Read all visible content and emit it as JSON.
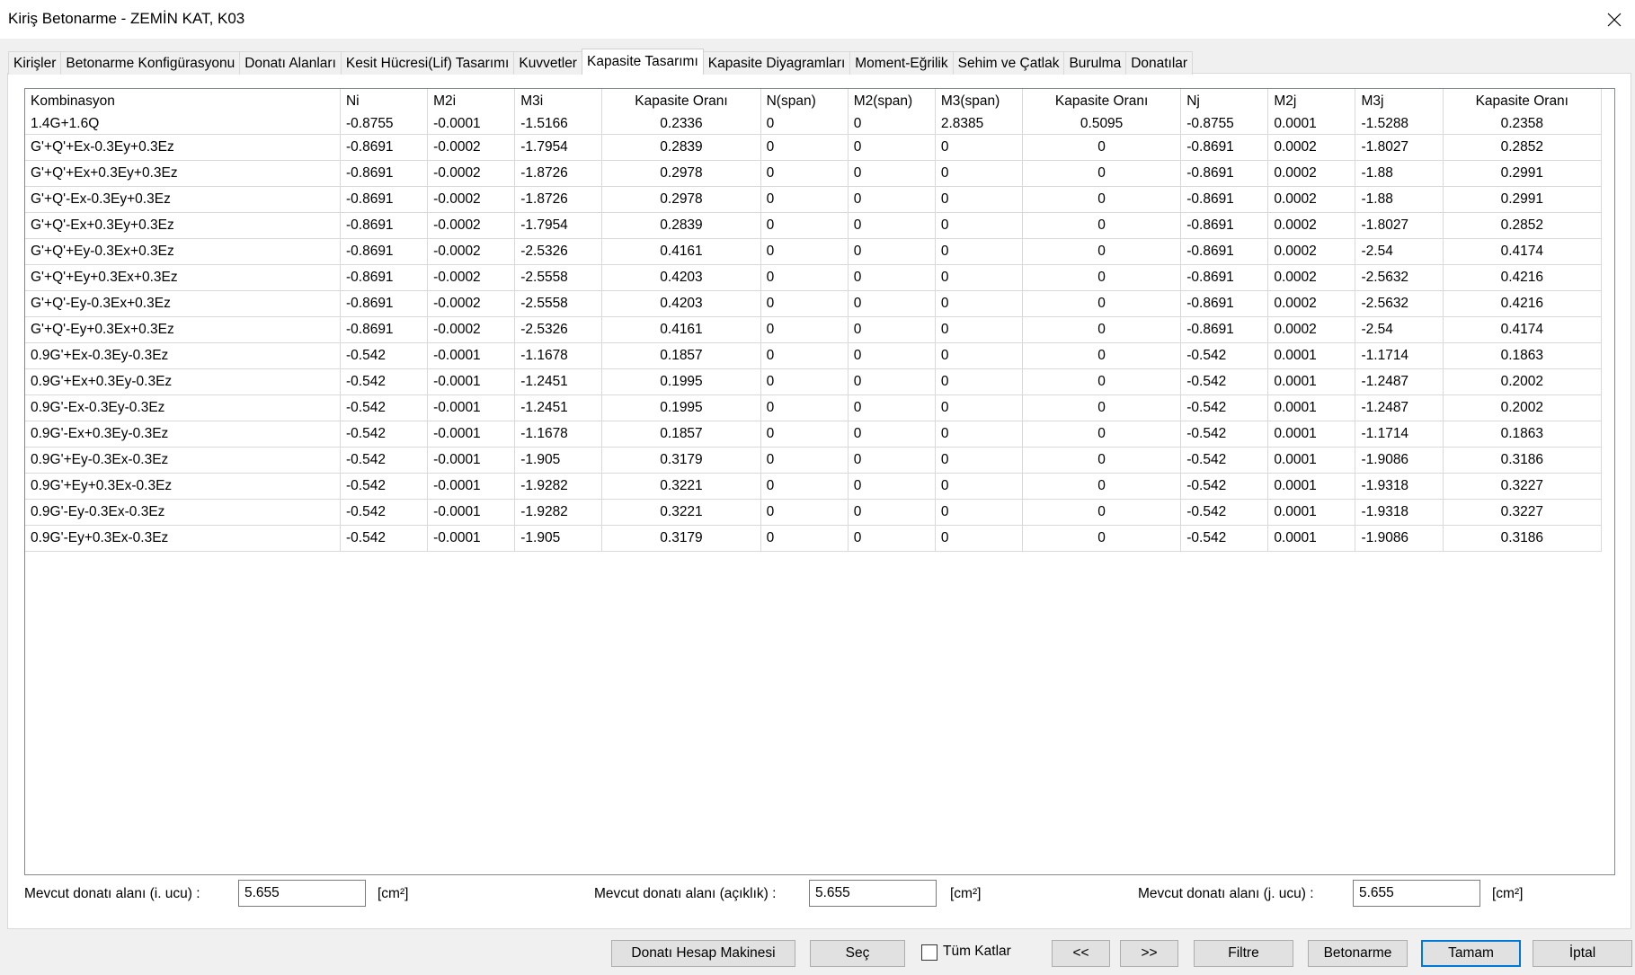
{
  "window": {
    "title": "Kiriş Betonarme - ZEMİN KAT, K03"
  },
  "tabs": [
    {
      "label": "Kirişler"
    },
    {
      "label": "Betonarme Konfigürasyonu"
    },
    {
      "label": "Donatı Alanları"
    },
    {
      "label": "Kesit Hücresi(Lif) Tasarımı"
    },
    {
      "label": "Kuvvetler"
    },
    {
      "label": "Kapasite Tasarımı",
      "active": true
    },
    {
      "label": "Kapasite Diyagramları"
    },
    {
      "label": "Moment-Eğrilik"
    },
    {
      "label": "Sehim ve Çatlak"
    },
    {
      "label": "Burulma"
    },
    {
      "label": "Donatılar"
    }
  ],
  "table": {
    "columns": [
      "Kombinasyon",
      "Ni",
      "M2i",
      "M3i",
      "Kapasite Oranı",
      "N(span)",
      "M2(span)",
      "M3(span)",
      "Kapasite Oranı",
      "Nj",
      "M2j",
      "M3j",
      "Kapasite Oranı"
    ],
    "rows": [
      [
        "1.4G+1.6Q",
        "-0.8755",
        "-0.0001",
        "-1.5166",
        "0.2336",
        "0",
        "0",
        "2.8385",
        "0.5095",
        "-0.8755",
        "0.0001",
        "-1.5288",
        "0.2358"
      ],
      [
        "G'+Q'+Ex-0.3Ey+0.3Ez",
        "-0.8691",
        "-0.0002",
        "-1.7954",
        "0.2839",
        "0",
        "0",
        "0",
        "0",
        "-0.8691",
        "0.0002",
        "-1.8027",
        "0.2852"
      ],
      [
        "G'+Q'+Ex+0.3Ey+0.3Ez",
        "-0.8691",
        "-0.0002",
        "-1.8726",
        "0.2978",
        "0",
        "0",
        "0",
        "0",
        "-0.8691",
        "0.0002",
        "-1.88",
        "0.2991"
      ],
      [
        "G'+Q'-Ex-0.3Ey+0.3Ez",
        "-0.8691",
        "-0.0002",
        "-1.8726",
        "0.2978",
        "0",
        "0",
        "0",
        "0",
        "-0.8691",
        "0.0002",
        "-1.88",
        "0.2991"
      ],
      [
        "G'+Q'-Ex+0.3Ey+0.3Ez",
        "-0.8691",
        "-0.0002",
        "-1.7954",
        "0.2839",
        "0",
        "0",
        "0",
        "0",
        "-0.8691",
        "0.0002",
        "-1.8027",
        "0.2852"
      ],
      [
        "G'+Q'+Ey-0.3Ex+0.3Ez",
        "-0.8691",
        "-0.0002",
        "-2.5326",
        "0.4161",
        "0",
        "0",
        "0",
        "0",
        "-0.8691",
        "0.0002",
        "-2.54",
        "0.4174"
      ],
      [
        "G'+Q'+Ey+0.3Ex+0.3Ez",
        "-0.8691",
        "-0.0002",
        "-2.5558",
        "0.4203",
        "0",
        "0",
        "0",
        "0",
        "-0.8691",
        "0.0002",
        "-2.5632",
        "0.4216"
      ],
      [
        "G'+Q'-Ey-0.3Ex+0.3Ez",
        "-0.8691",
        "-0.0002",
        "-2.5558",
        "0.4203",
        "0",
        "0",
        "0",
        "0",
        "-0.8691",
        "0.0002",
        "-2.5632",
        "0.4216"
      ],
      [
        "G'+Q'-Ey+0.3Ex+0.3Ez",
        "-0.8691",
        "-0.0002",
        "-2.5326",
        "0.4161",
        "0",
        "0",
        "0",
        "0",
        "-0.8691",
        "0.0002",
        "-2.54",
        "0.4174"
      ],
      [
        "0.9G'+Ex-0.3Ey-0.3Ez",
        "-0.542",
        "-0.0001",
        "-1.1678",
        "0.1857",
        "0",
        "0",
        "0",
        "0",
        "-0.542",
        "0.0001",
        "-1.1714",
        "0.1863"
      ],
      [
        "0.9G'+Ex+0.3Ey-0.3Ez",
        "-0.542",
        "-0.0001",
        "-1.2451",
        "0.1995",
        "0",
        "0",
        "0",
        "0",
        "-0.542",
        "0.0001",
        "-1.2487",
        "0.2002"
      ],
      [
        "0.9G'-Ex-0.3Ey-0.3Ez",
        "-0.542",
        "-0.0001",
        "-1.2451",
        "0.1995",
        "0",
        "0",
        "0",
        "0",
        "-0.542",
        "0.0001",
        "-1.2487",
        "0.2002"
      ],
      [
        "0.9G'-Ex+0.3Ey-0.3Ez",
        "-0.542",
        "-0.0001",
        "-1.1678",
        "0.1857",
        "0",
        "0",
        "0",
        "0",
        "-0.542",
        "0.0001",
        "-1.1714",
        "0.1863"
      ],
      [
        "0.9G'+Ey-0.3Ex-0.3Ez",
        "-0.542",
        "-0.0001",
        "-1.905",
        "0.3179",
        "0",
        "0",
        "0",
        "0",
        "-0.542",
        "0.0001",
        "-1.9086",
        "0.3186"
      ],
      [
        "0.9G'+Ey+0.3Ex-0.3Ez",
        "-0.542",
        "-0.0001",
        "-1.9282",
        "0.3221",
        "0",
        "0",
        "0",
        "0",
        "-0.542",
        "0.0001",
        "-1.9318",
        "0.3227"
      ],
      [
        "0.9G'-Ey-0.3Ex-0.3Ez",
        "-0.542",
        "-0.0001",
        "-1.9282",
        "0.3221",
        "0",
        "0",
        "0",
        "0",
        "-0.542",
        "0.0001",
        "-1.9318",
        "0.3227"
      ],
      [
        "0.9G'-Ey+0.3Ex-0.3Ez",
        "-0.542",
        "-0.0001",
        "-1.905",
        "0.3179",
        "0",
        "0",
        "0",
        "0",
        "-0.542",
        "0.0001",
        "-1.9086",
        "0.3186"
      ]
    ]
  },
  "fields": {
    "i_label": "Mevcut donatı alanı (i. ucu) :",
    "i_value": "5.655",
    "span_label": "Mevcut donatı alanı (açıklık) :",
    "span_value": "5.655",
    "j_label": "Mevcut donatı alanı (j. ucu) :",
    "j_value": "5.655",
    "unit": "[cm²]"
  },
  "buttons": {
    "calculator": "Donatı Hesap Makinesi",
    "select": "Seç",
    "all_floors": "Tüm Katlar",
    "prev": "<<",
    "next": ">>",
    "filter": "Filtre",
    "concrete": "Betonarme",
    "ok": "Tamam",
    "cancel": "İptal"
  },
  "colors": {
    "accent": "#0078d7",
    "grid_border": "#d9d9d9"
  }
}
